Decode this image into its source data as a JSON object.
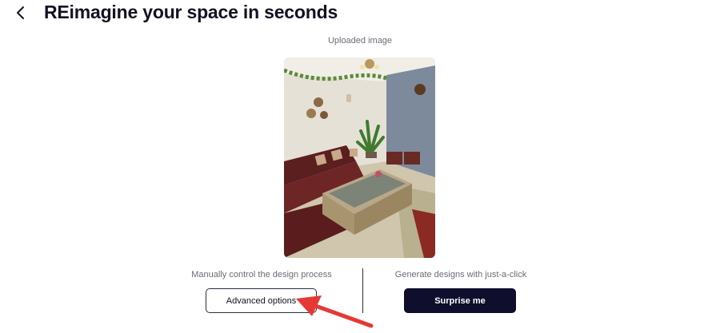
{
  "header": {
    "back_icon": "chevron-left-icon",
    "title": "REimagine your space in seconds"
  },
  "upload": {
    "caption": "Uploaded image"
  },
  "actions": {
    "manual_hint": "Manually control the design process",
    "advanced_label": "Advanced options",
    "auto_hint": "Generate designs with just-a-click",
    "surprise_label": "Surprise me"
  },
  "annotation": {
    "arrow_color": "#e53935"
  },
  "colors": {
    "primary_button": "#0f0f2d",
    "title": "#111322"
  }
}
